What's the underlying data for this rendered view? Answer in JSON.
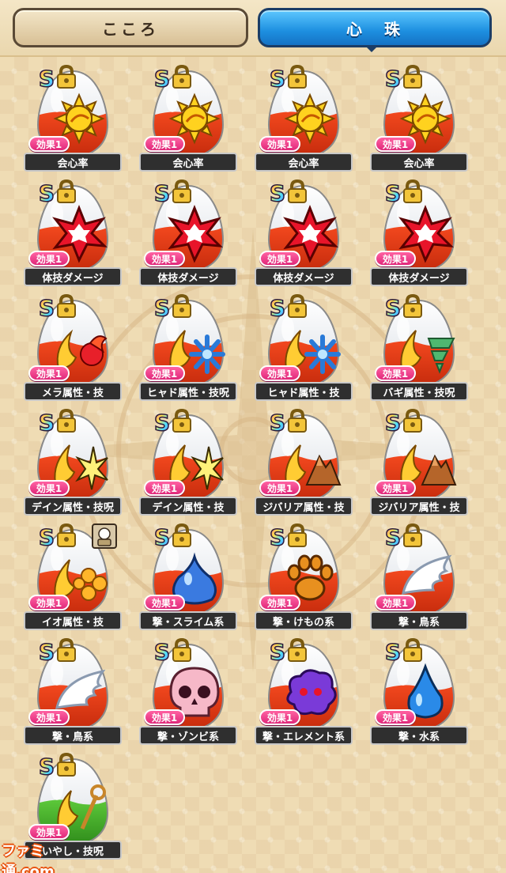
{
  "tabs": [
    {
      "label": "こころ",
      "active": false
    },
    {
      "label": "心　珠",
      "active": true
    }
  ],
  "colors": {
    "active_tab": "#1d8fe0",
    "effect_tag": "#e0287a",
    "background": "#efdcb4"
  },
  "badge_text": "S",
  "effect_label": "効果1",
  "orbs": [
    {
      "name": "会心率",
      "icon": "sun-icon",
      "fill": "red"
    },
    {
      "name": "会心率",
      "icon": "sun-icon",
      "fill": "red"
    },
    {
      "name": "会心率",
      "icon": "sun-icon",
      "fill": "red"
    },
    {
      "name": "会心率",
      "icon": "sun-icon",
      "fill": "red"
    },
    {
      "name": "体技ダメージ",
      "icon": "burst-icon",
      "fill": "red"
    },
    {
      "name": "体技ダメージ",
      "icon": "burst-icon",
      "fill": "red"
    },
    {
      "name": "体技ダメージ",
      "icon": "burst-icon",
      "fill": "red"
    },
    {
      "name": "体技ダメージ",
      "icon": "burst-icon",
      "fill": "red"
    },
    {
      "name": "メラ属性・技",
      "icon": "fire-icon",
      "fill": "red"
    },
    {
      "name": "ヒャド属性・技呪",
      "icon": "ice-icon",
      "fill": "red"
    },
    {
      "name": "ヒャド属性・技",
      "icon": "ice-icon",
      "fill": "red"
    },
    {
      "name": "バギ属性・技呪",
      "icon": "wind-icon",
      "fill": "red"
    },
    {
      "name": "デイン属性・技呪",
      "icon": "lightning-icon",
      "fill": "red"
    },
    {
      "name": "デイン属性・技",
      "icon": "lightning-icon",
      "fill": "red"
    },
    {
      "name": "ジバリア属性・技",
      "icon": "earth-icon",
      "fill": "red"
    },
    {
      "name": "ジバリア属性・技",
      "icon": "earth-icon",
      "fill": "red"
    },
    {
      "name": "イオ属性・技",
      "icon": "explosion-icon",
      "fill": "red",
      "extra": true
    },
    {
      "name": "撃・スライム系",
      "icon": "slime-icon",
      "fill": "red"
    },
    {
      "name": "撃・けもの系",
      "icon": "paw-icon",
      "fill": "red"
    },
    {
      "name": "撃・鳥系",
      "icon": "wing-icon",
      "fill": "red"
    },
    {
      "name": "撃・鳥系",
      "icon": "wing-icon",
      "fill": "red"
    },
    {
      "name": "撃・ゾンビ系",
      "icon": "skull-icon",
      "fill": "red"
    },
    {
      "name": "撃・エレメント系",
      "icon": "element-icon",
      "fill": "red"
    },
    {
      "name": "撃・水系",
      "icon": "water-drop-icon",
      "fill": "red"
    },
    {
      "name": "いやし・技呪",
      "icon": "staff-icon",
      "fill": "green"
    }
  ],
  "footer_logo": "ファミ通.com"
}
